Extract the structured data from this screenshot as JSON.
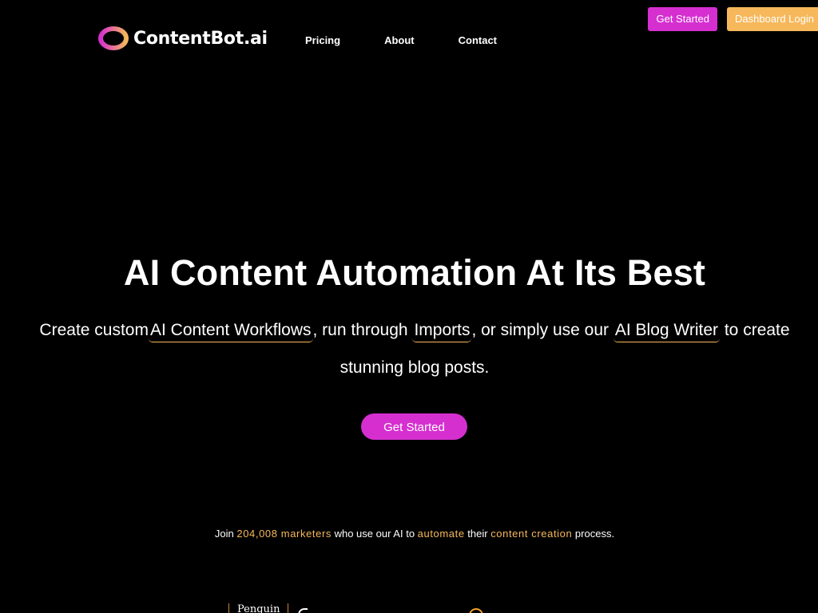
{
  "brand": {
    "name": "ContentBot.ai",
    "ring_gradient": [
      "#d62fd0",
      "#f6b85b"
    ]
  },
  "nav": {
    "items": [
      "Pricing",
      "About",
      "Contact"
    ]
  },
  "header_buttons": {
    "get_started": "Get Started",
    "dashboard_login": "Dashboard Login"
  },
  "hero": {
    "title": "AI Content Automation At Its Best",
    "subtitle": {
      "part1": "Create custom",
      "link1": "AI Content Workflows",
      "part2": ", run through ",
      "link2": "Imports",
      "part3": ", or simply use our ",
      "link3": "AI Blog Writer",
      "part4": " to create stunning blog posts."
    },
    "cta": "Get Started"
  },
  "social_proof": {
    "t1": "Join ",
    "count": "204,008 marketers",
    "t2": " who use our AI to ",
    "a1": "automate",
    "t3": " their ",
    "a2": "content creation",
    "t4": " process."
  },
  "client_logos": {
    "penguin": "Penguin"
  },
  "colors": {
    "background": "#000000",
    "primary": "#d62fd0",
    "accent": "#f6b85b",
    "text": "#ffffff"
  }
}
